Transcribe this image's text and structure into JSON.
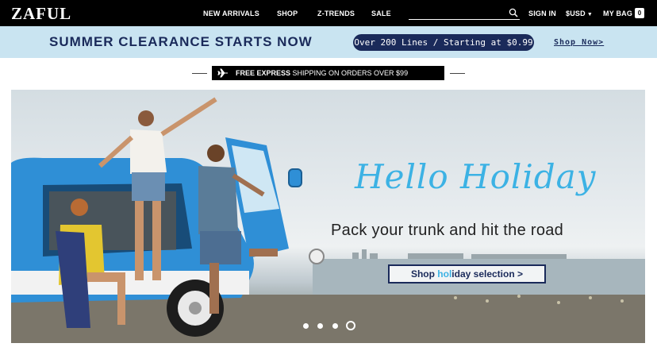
{
  "header": {
    "logo": "ZAFUL",
    "nav": [
      "NEW ARRIVALS",
      "SHOP",
      "Z-TRENDS",
      "SALE"
    ],
    "search_placeholder": "",
    "sign_in": "SIGN IN",
    "currency": "$USD",
    "bag_label": "MY BAG",
    "bag_count": "0"
  },
  "promo": {
    "title": "SUMMER CLEARANCE STARTS NOW",
    "pill": "Over 200 Lines  /  Starting at $0.99",
    "link": "Shop Now>"
  },
  "shipping": {
    "bold": "FREE EXPRESS",
    "rest": " SHIPPING ON ORDERS OVER $99"
  },
  "hero": {
    "headline": "Hello Holiday",
    "subhead": "Pack your trunk and hit the road",
    "cta_a": "Shop ",
    "cta_b": "hol",
    "cta_c": "iday selection >",
    "slides": 4,
    "active_slide": 4
  },
  "colors": {
    "accent_navy": "#1a2a5a",
    "accent_sky": "#3cb2e4",
    "promo_bg": "#c9e4f1",
    "van_blue": "#2f8fd6"
  }
}
